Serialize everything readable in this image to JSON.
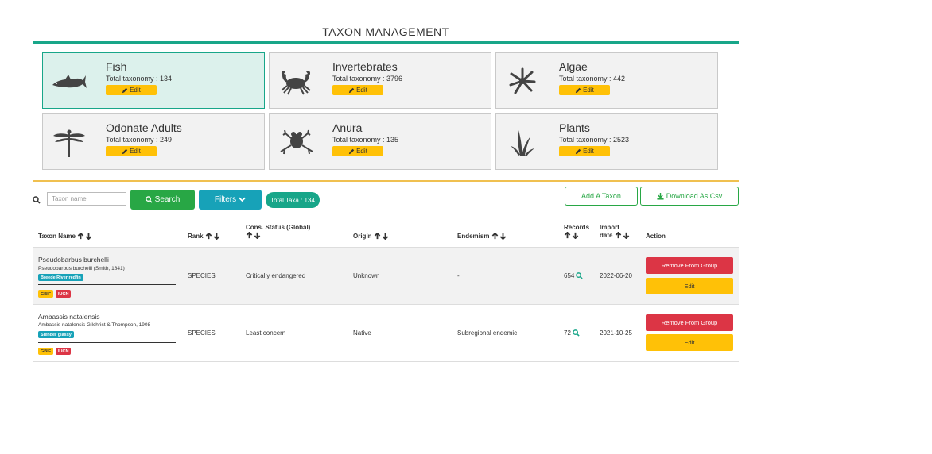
{
  "page": {
    "title": "TAXON MANAGEMENT"
  },
  "groups": [
    {
      "name": "Fish",
      "count": "Total taxonomy : 134",
      "edit": "Edit",
      "icon": "fish-icon",
      "active": true
    },
    {
      "name": "Invertebrates",
      "count": "Total taxonomy : 3796",
      "edit": "Edit",
      "icon": "crab-icon"
    },
    {
      "name": "Algae",
      "count": "Total taxonomy : 442",
      "edit": "Edit",
      "icon": "algae-icon"
    },
    {
      "name": "Odonate Adults",
      "count": "Total taxonomy : 249",
      "edit": "Edit",
      "icon": "dragonfly-icon"
    },
    {
      "name": "Anura",
      "count": "Total taxonomy : 135",
      "edit": "Edit",
      "icon": "frog-icon"
    },
    {
      "name": "Plants",
      "count": "Total taxonomy : 2523",
      "edit": "Edit",
      "icon": "plant-icon"
    }
  ],
  "toolbar": {
    "search_placeholder": "Taxon name",
    "search_label": "Search",
    "filters_label": "Filters",
    "total_label": "Total Taxa : 134",
    "add_label": "Add A Taxon",
    "download_label": "Download As Csv"
  },
  "table": {
    "headers": {
      "taxon_name": "Taxon Name",
      "rank": "Rank",
      "cons_status_1": "Cons. Status (Global)",
      "origin": "Origin",
      "endemism": "Endemism",
      "records": "Records",
      "import_date_1": "Import",
      "import_date_2": "date",
      "action": "Action"
    },
    "rows": [
      {
        "name": "Pseudobarbus burchelli",
        "authority": "Pseudobarbus burchelli (Smith, 1841)",
        "common_name": "Breede River redfin",
        "tags": [
          "GBIF",
          "IUCN"
        ],
        "rank": "SPECIES",
        "cons_status": "Critically endangered",
        "origin": "Unknown",
        "endemism": "-",
        "records": "654",
        "import_date": "2022-06-20",
        "remove_label": "Remove From Group",
        "edit_label": "Edit"
      },
      {
        "name": "Ambassis natalensis",
        "authority": "Ambassis natalensis Gilchrist & Thompson, 1908",
        "common_name": "Slender glassy",
        "tags": [
          "GBIF",
          "IUCN"
        ],
        "rank": "SPECIES",
        "cons_status": "Least concern",
        "origin": "Native",
        "endemism": "Subregional endemic",
        "records": "72",
        "import_date": "2021-10-25",
        "remove_label": "Remove From Group",
        "edit_label": "Edit"
      }
    ]
  },
  "colors": {
    "accent": "#18a689",
    "success": "#28a745",
    "info": "#17a2b8",
    "warning": "#ffc107",
    "danger": "#dc3545"
  }
}
